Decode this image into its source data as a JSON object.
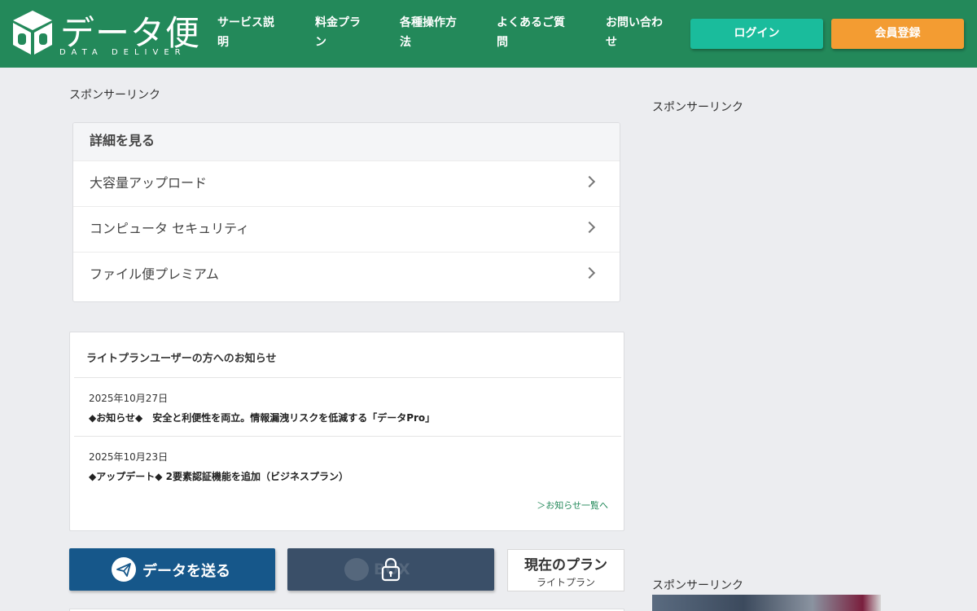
{
  "header": {
    "logo_title": "データ便",
    "logo_subtitle": "DATA DELIVER",
    "nav": [
      {
        "line1": "サービス説",
        "line2": "明"
      },
      {
        "line1": "料金プラ",
        "line2": "ン"
      },
      {
        "line1": "各種操作方",
        "line2": "法"
      },
      {
        "line1": "よくあるご質",
        "line2": "問"
      },
      {
        "line1": "お問い合わ",
        "line2": "せ"
      }
    ],
    "login_label": "ログイン",
    "register_label": "会員登録",
    "colors": {
      "header_bg": "#23895a",
      "login": "#1abc9c",
      "register": "#f39c32"
    }
  },
  "main": {
    "sponsor_label": "スポンサーリンク",
    "details": {
      "heading": "詳細を見る",
      "items": [
        "大容量アップロード",
        "コンピュータ セキュリティ",
        "ファイル便プレミアム"
      ]
    },
    "notice": {
      "title": "ライトプランユーザーの方へのお知らせ",
      "items": [
        {
          "date": "2025年10月27日",
          "text": "◆お知らせ◆　安全と利便性を両立。情報漏洩リスクを低減する「データPro」"
        },
        {
          "date": "2025年10月23日",
          "text": "◆アップデート◆ 2要素認証機能を追加（ビジネスプラン）"
        }
      ],
      "more_link": "＞お知らせ一覧へ"
    },
    "actions": {
      "send_label": "データを送る",
      "box_label": "BOX",
      "plan_title": "現在のプラン",
      "plan_name": "ライトプラン"
    }
  },
  "sidebar": {
    "sponsor_top": "スポンサーリンク",
    "sponsor_bottom": "スポンサーリンク"
  },
  "icons": [
    "logo-cube-icon",
    "chevron-right-icon",
    "paper-plane-icon",
    "box-icon",
    "lock-icon"
  ]
}
